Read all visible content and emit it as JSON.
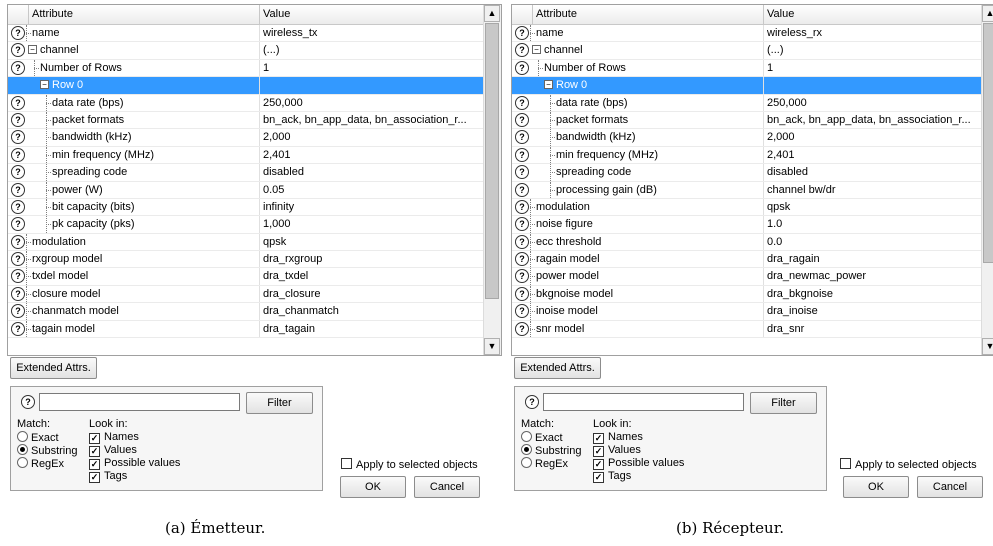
{
  "panels": [
    {
      "header": {
        "attribute": "Attribute",
        "value": "Value"
      },
      "rows": [
        {
          "name": "name",
          "value": "wireless_tx",
          "indent": 1,
          "help": true
        },
        {
          "name": "channel",
          "value": "(...)",
          "indent": 0,
          "help": true,
          "toggle": "⊟"
        },
        {
          "name": "Number of Rows",
          "value": "1",
          "indent": 2,
          "help": true
        },
        {
          "name": "Row 0",
          "value": "",
          "indent": 2,
          "help": false,
          "toggle": "⊟",
          "selected": true
        },
        {
          "name": "data rate (bps)",
          "value": "250,000",
          "indent": 3,
          "help": true
        },
        {
          "name": "packet formats",
          "value": "bn_ack, bn_app_data, bn_association_r...",
          "indent": 3,
          "help": true
        },
        {
          "name": "bandwidth (kHz)",
          "value": "2,000",
          "indent": 3,
          "help": true
        },
        {
          "name": "min frequency (MHz)",
          "value": "2,401",
          "indent": 3,
          "help": true
        },
        {
          "name": "spreading code",
          "value": "disabled",
          "indent": 3,
          "help": true
        },
        {
          "name": "power (W)",
          "value": "0.05",
          "indent": 3,
          "help": true
        },
        {
          "name": "bit capacity (bits)",
          "value": "infinity",
          "indent": 3,
          "help": true
        },
        {
          "name": "pk capacity (pks)",
          "value": "1,000",
          "indent": 3,
          "help": true
        },
        {
          "name": "modulation",
          "value": "qpsk",
          "indent": 1,
          "help": true
        },
        {
          "name": "rxgroup model",
          "value": "dra_rxgroup",
          "indent": 1,
          "help": true
        },
        {
          "name": "txdel model",
          "value": "dra_txdel",
          "indent": 1,
          "help": true
        },
        {
          "name": "closure model",
          "value": "dra_closure",
          "indent": 1,
          "help": true
        },
        {
          "name": "chanmatch model",
          "value": "dra_chanmatch",
          "indent": 1,
          "help": true
        },
        {
          "name": "tagain model",
          "value": "dra_tagain",
          "indent": 1,
          "help": true
        }
      ],
      "extended_label": "Extended Attrs.",
      "filter": {
        "input_value": "",
        "button_label": "Filter",
        "match_label": "Match:",
        "match_options": [
          {
            "label": "Exact",
            "checked": false
          },
          {
            "label": "Substring",
            "checked": true
          },
          {
            "label": "RegEx",
            "checked": false
          }
        ],
        "lookin_label": "Look in:",
        "lookin_options": [
          {
            "label": "Names",
            "checked": true
          },
          {
            "label": "Values",
            "checked": true
          },
          {
            "label": "Possible values",
            "checked": true
          },
          {
            "label": "Tags",
            "checked": true
          }
        ]
      },
      "apply_label": "Apply to selected objects",
      "ok_label": "OK",
      "cancel_label": "Cancel",
      "caption": "(a) Émetteur."
    },
    {
      "header": {
        "attribute": "Attribute",
        "value": "Value"
      },
      "rows": [
        {
          "name": "name",
          "value": "wireless_rx",
          "indent": 1,
          "help": true
        },
        {
          "name": "channel",
          "value": "(...)",
          "indent": 0,
          "help": true,
          "toggle": "⊟"
        },
        {
          "name": "Number of Rows",
          "value": "1",
          "indent": 2,
          "help": true
        },
        {
          "name": "Row 0",
          "value": "",
          "indent": 2,
          "help": false,
          "toggle": "⊟",
          "selected": true
        },
        {
          "name": "data rate (bps)",
          "value": "250,000",
          "indent": 3,
          "help": true
        },
        {
          "name": "packet formats",
          "value": "bn_ack, bn_app_data, bn_association_r...",
          "indent": 3,
          "help": true
        },
        {
          "name": "bandwidth (kHz)",
          "value": "2,000",
          "indent": 3,
          "help": true
        },
        {
          "name": "min frequency (MHz)",
          "value": "2,401",
          "indent": 3,
          "help": true
        },
        {
          "name": "spreading code",
          "value": "disabled",
          "indent": 3,
          "help": true
        },
        {
          "name": "processing gain (dB)",
          "value": "channel bw/dr",
          "indent": 3,
          "help": true
        },
        {
          "name": "modulation",
          "value": "qpsk",
          "indent": 1,
          "help": true
        },
        {
          "name": "noise figure",
          "value": "1.0",
          "indent": 1,
          "help": true
        },
        {
          "name": "ecc threshold",
          "value": "0.0",
          "indent": 1,
          "help": true
        },
        {
          "name": "ragain model",
          "value": "dra_ragain",
          "indent": 1,
          "help": true
        },
        {
          "name": "power model",
          "value": "dra_newmac_power",
          "indent": 1,
          "help": true
        },
        {
          "name": "bkgnoise model",
          "value": "dra_bkgnoise",
          "indent": 1,
          "help": true
        },
        {
          "name": "inoise model",
          "value": "dra_inoise",
          "indent": 1,
          "help": true
        },
        {
          "name": "snr model",
          "value": "dra_snr",
          "indent": 1,
          "help": true
        }
      ],
      "extended_label": "Extended Attrs.",
      "filter": {
        "input_value": "",
        "button_label": "Filter",
        "match_label": "Match:",
        "match_options": [
          {
            "label": "Exact",
            "checked": false
          },
          {
            "label": "Substring",
            "checked": true
          },
          {
            "label": "RegEx",
            "checked": false
          }
        ],
        "lookin_label": "Look in:",
        "lookin_options": [
          {
            "label": "Names",
            "checked": true
          },
          {
            "label": "Values",
            "checked": true
          },
          {
            "label": "Possible values",
            "checked": true
          },
          {
            "label": "Tags",
            "checked": true
          }
        ]
      },
      "apply_label": "Apply to selected objects",
      "ok_label": "OK",
      "cancel_label": "Cancel",
      "caption": "(b) Récepteur."
    }
  ],
  "icons": {
    "help": "?",
    "checkmark": "✓",
    "up_arrow": "▲",
    "down_arrow": "▼"
  },
  "colors": {
    "selection": "#3399ff",
    "window": "#ffffff"
  }
}
